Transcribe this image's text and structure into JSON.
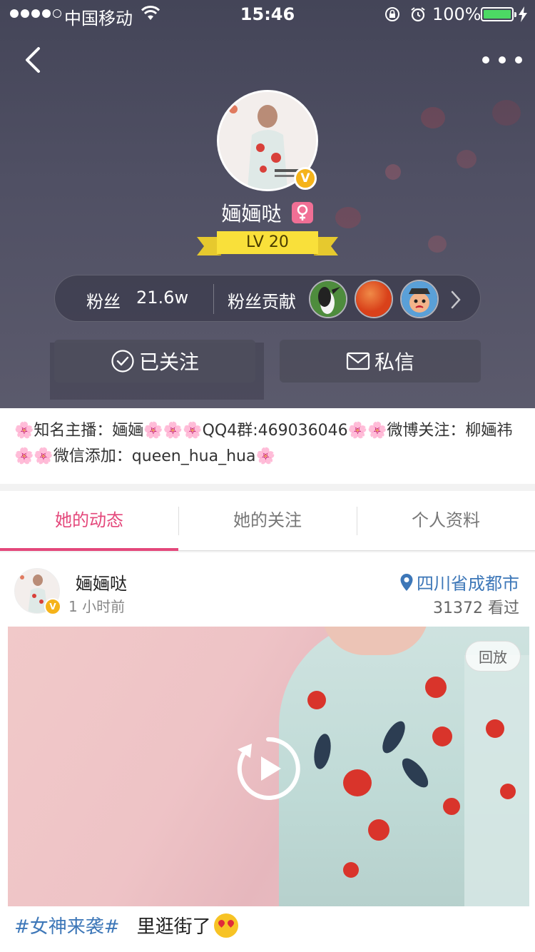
{
  "status_bar": {
    "carrier": "中国移动",
    "time": "15:46",
    "battery_percent": "100%"
  },
  "profile": {
    "nickname": "婳婳哒",
    "level": "LV 20",
    "verified_mark": "V"
  },
  "stats": {
    "fans_label": "粉丝",
    "fans_count": "21.6w",
    "contribution_label": "粉丝贡献"
  },
  "actions": {
    "follow_label": "已关注",
    "message_label": "私信"
  },
  "bio": {
    "text": "🌸知名主播：婳婳🌸🌸🌸QQ4群:469036046🌸🌸微博关注：柳婳祎🌸🌸微信添加：queen_hua_hua🌸"
  },
  "tabs": [
    {
      "label": "她的动态",
      "active": true
    },
    {
      "label": "她的关注",
      "active": false
    },
    {
      "label": "个人资料",
      "active": false
    }
  ],
  "post": {
    "author": "婳婳哒",
    "time": "1 小时前",
    "location": "四川省成都市",
    "views": "31372 看过",
    "replay_label": "回放",
    "hashtag": "#女神来袭#",
    "caption": "里逛街了"
  },
  "colors": {
    "accent": "#e4487b",
    "link": "#3d77b8",
    "verified": "#f5b31a",
    "level_ribbon": "#f9e03a"
  }
}
